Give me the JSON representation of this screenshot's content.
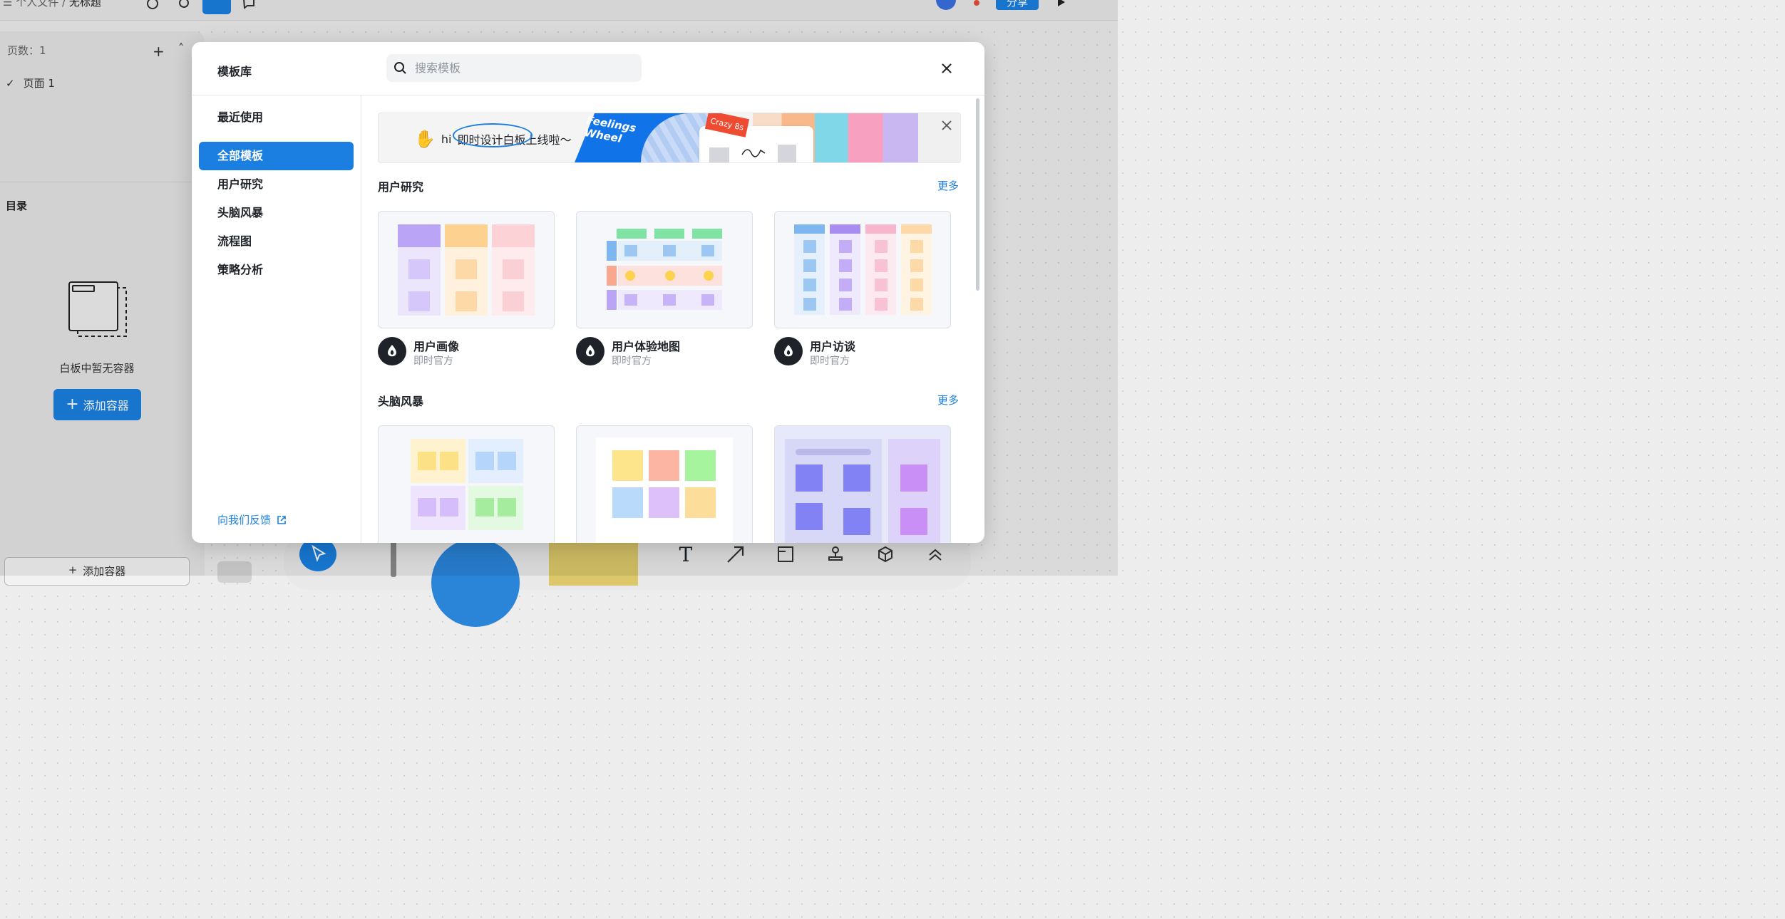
{
  "topbar": {
    "breadcrumb_folder": "个人文件",
    "breadcrumb_sep": " / ",
    "breadcrumb_file": "无标题",
    "share_label": "分享"
  },
  "left_panel": {
    "pages_label": "页数：1",
    "pages": [
      {
        "label": "页面 1",
        "selected": true
      }
    ],
    "toc_title": "目录",
    "empty_text": "白板中暂无容器",
    "add_container_label": "添加容器",
    "add_container_bottom_label": "添加容器"
  },
  "modal": {
    "title": "模板库",
    "search_placeholder": "搜索模板",
    "sidebar": [
      {
        "label": "最近使用",
        "active": false
      },
      {
        "label": "全部模板",
        "active": true
      },
      {
        "label": "用户研究",
        "active": false
      },
      {
        "label": "头脑风暴",
        "active": false
      },
      {
        "label": "流程图",
        "active": false
      },
      {
        "label": "策略分析",
        "active": false
      }
    ],
    "feedback_label": "向我们反馈",
    "banner": {
      "greeting": "hi",
      "text_highlight": "即时设计白板",
      "text_rest": "上线啦～",
      "feelings_wheel": "Feelings Wheel",
      "crazy8s": "Crazy 8s"
    },
    "sections": [
      {
        "title": "用户研究",
        "more": "更多",
        "cards": [
          {
            "name": "用户画像",
            "author": "即时官方"
          },
          {
            "name": "用户体验地图",
            "author": "即时官方"
          },
          {
            "name": "用户访谈",
            "author": "即时官方"
          }
        ]
      },
      {
        "title": "头脑风暴",
        "more": "更多"
      }
    ]
  },
  "colors": {
    "accent": "#1a7fe0",
    "text": "#1f2329",
    "muted": "#8f959e"
  }
}
